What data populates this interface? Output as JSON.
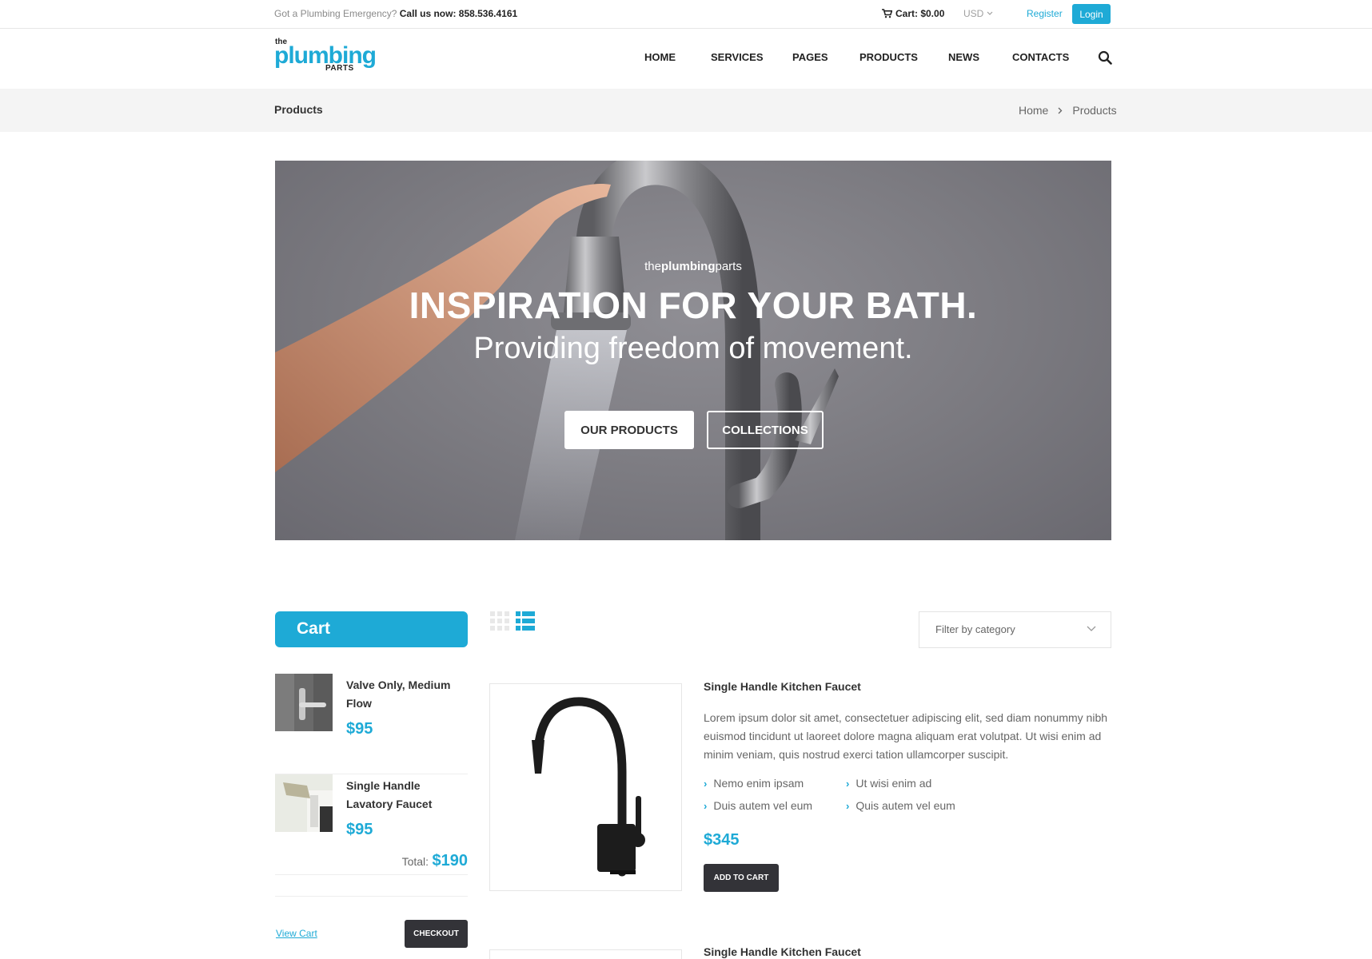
{
  "topbar": {
    "emergency_text": "Got a Plumbing Emergency?",
    "call_text": "Call us now: 858.536.4161",
    "cart_text": "Cart: $0.00",
    "currency": "USD",
    "register": "Register",
    "login": "Login"
  },
  "header": {
    "logo": {
      "the": "the",
      "plumbing": "plumbing",
      "parts": "PARTS"
    },
    "nav": [
      "HOME",
      "SERVICES",
      "PAGES",
      "PRODUCTS",
      "NEWS",
      "CONTACTS"
    ]
  },
  "breadcrumb": {
    "page_title": "Products",
    "items": [
      "Home",
      "Products"
    ]
  },
  "hero": {
    "brand_the": "the",
    "brand_plumbing": "plumbing",
    "brand_parts": "parts",
    "headline": "INSPIRATION FOR YOUR BATH.",
    "subheadline": "Providing freedom of movement.",
    "primary_button": "OUR PRODUCTS",
    "secondary_button": "COLLECTIONS"
  },
  "cart": {
    "title": "Cart",
    "items": [
      {
        "name": "Valve Only, Medium Flow",
        "price": "$95"
      },
      {
        "name": "Single Handle Lavatory Faucet",
        "price": "$95"
      }
    ],
    "total_label": "Total:",
    "total_value": "$190",
    "view_cart": "View Cart",
    "checkout": "CHECKOUT"
  },
  "products": {
    "filter_placeholder": "Filter by category",
    "items": [
      {
        "title": "Single Handle Kitchen Faucet",
        "description": "Lorem ipsum dolor sit amet, consectetuer adipiscing elit, sed diam nonummy nibh euismod tincidunt ut laoreet dolore magna aliquam erat volutpat. Ut wisi enim ad minim veniam, quis nostrud exerci tation ullamcorper suscipit.",
        "features": [
          "Nemo enim ipsam",
          "Ut wisi enim ad",
          "Duis autem vel eum",
          "Quis autem vel eum"
        ],
        "price": "$345",
        "add_to_cart": "ADD TO CART"
      },
      {
        "title": "Single Handle Kitchen Faucet"
      }
    ]
  },
  "colors": {
    "accent": "#1eaad6",
    "dark_button": "#333338",
    "breadcrumb_bg": "#f4f4f4"
  }
}
